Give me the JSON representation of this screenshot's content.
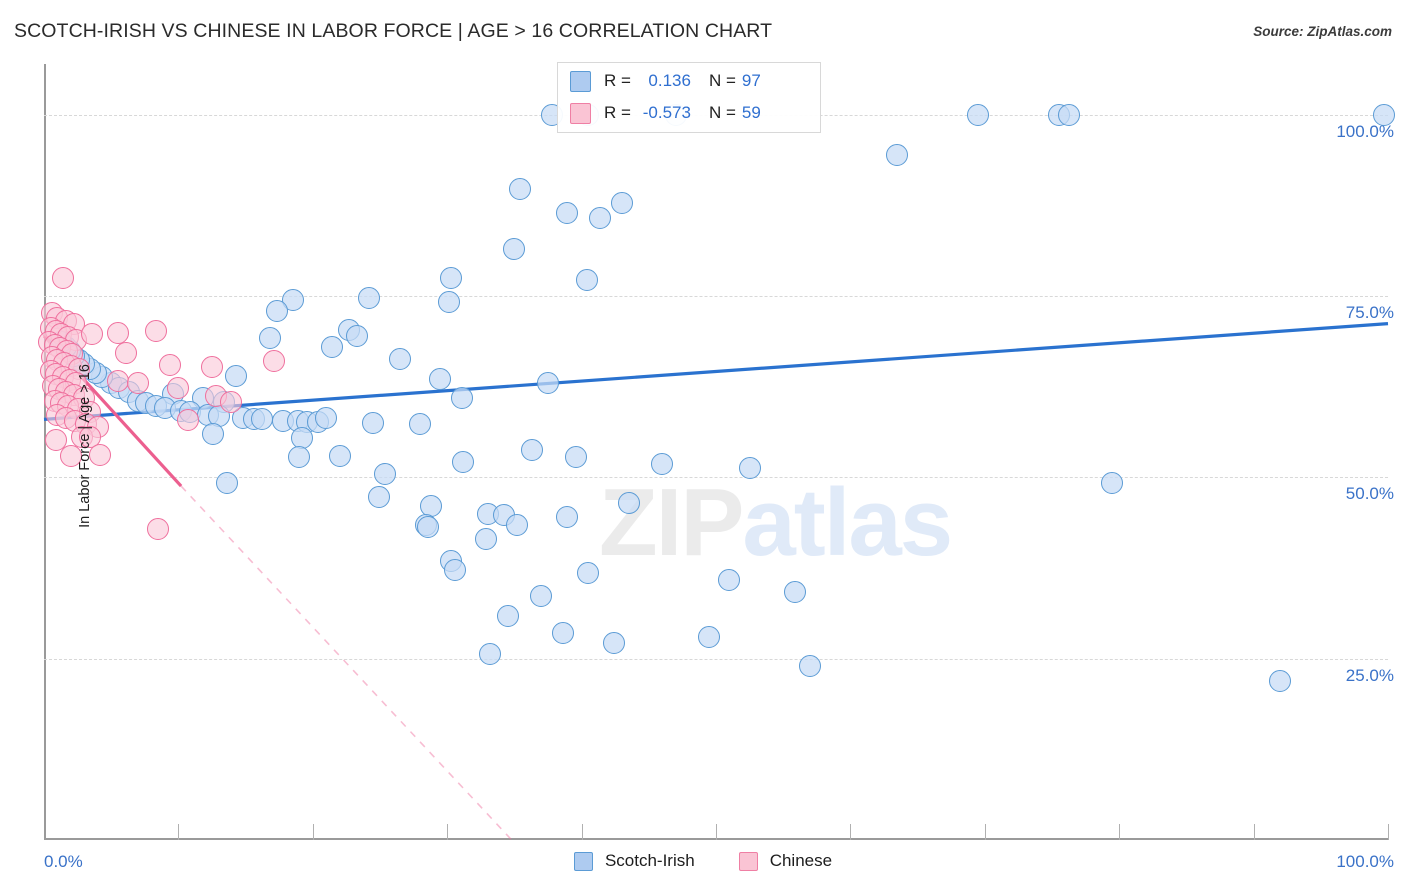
{
  "header": {
    "title": "SCOTCH-IRISH VS CHINESE IN LABOR FORCE | AGE > 16 CORRELATION CHART",
    "source": "Source: ZipAtlas.com"
  },
  "watermark": {
    "part1": "ZIP",
    "part2": "atlas"
  },
  "stats": {
    "blue": {
      "r_label": "R =",
      "r_value": "0.136",
      "n_label": "N =",
      "n_value": "97"
    },
    "pink": {
      "r_label": "R =",
      "r_value": "-0.573",
      "n_label": "N =",
      "n_value": "59"
    }
  },
  "legend": [
    {
      "label": "Scotch-Irish",
      "color": "#aecbf0"
    },
    {
      "label": "Chinese",
      "color": "#fac4d4"
    }
  ],
  "axes": {
    "y_title": "In Labor Force | Age > 16",
    "y_ticks": [
      "100.0%",
      "75.0%",
      "50.0%",
      "25.0%"
    ],
    "x_min": "0.0%",
    "x_max": "100.0%"
  },
  "chart_data": {
    "type": "scatter",
    "title": "SCOTCH-IRISH VS CHINESE IN LABOR FORCE | AGE > 16 CORRELATION CHART",
    "xlabel": "",
    "ylabel": "In Labor Force | Age > 16",
    "xlim": [
      0,
      100
    ],
    "ylim": [
      0,
      107
    ],
    "x_ticks": [
      0,
      10,
      20,
      30,
      40,
      50,
      60,
      70,
      80,
      90,
      100
    ],
    "y_gridlines": [
      25,
      50,
      75,
      100
    ],
    "grid": true,
    "legend_position": "bottom-center",
    "accent_blue": "#3a72c8",
    "accent_pink": "#ef6f9d",
    "series": [
      {
        "name": "Scotch-Irish",
        "r": 0.136,
        "n": 97,
        "color": "#aecbf0",
        "edge": "#5b9bd5",
        "trendline": {
          "x0": 0,
          "y0": 58.0,
          "x1": 100,
          "y1": 71.2,
          "style": "solid"
        },
        "points": [
          [
            37.8,
            100.0
          ],
          [
            40.5,
            100.0
          ],
          [
            47.0,
            100.0
          ],
          [
            69.5,
            100.0
          ],
          [
            75.5,
            100.0
          ],
          [
            76.3,
            100.0
          ],
          [
            99.7,
            100.0
          ],
          [
            63.5,
            94.5
          ],
          [
            35.4,
            89.8
          ],
          [
            43.0,
            87.8
          ],
          [
            38.9,
            86.5
          ],
          [
            41.4,
            85.7
          ],
          [
            35.0,
            81.5
          ],
          [
            30.3,
            77.5
          ],
          [
            40.4,
            77.2
          ],
          [
            18.5,
            74.5
          ],
          [
            24.2,
            74.8
          ],
          [
            30.1,
            74.2
          ],
          [
            17.3,
            73.0
          ],
          [
            22.7,
            70.3
          ],
          [
            16.8,
            69.2
          ],
          [
            23.3,
            69.5
          ],
          [
            21.4,
            68.0
          ],
          [
            26.5,
            66.3
          ],
          [
            14.3,
            64.0
          ],
          [
            29.5,
            63.5
          ],
          [
            37.5,
            63.0
          ],
          [
            9.6,
            61.5
          ],
          [
            11.8,
            61.0
          ],
          [
            13.4,
            60.4
          ],
          [
            31.1,
            61.0
          ],
          [
            5.0,
            63.0
          ],
          [
            5.6,
            62.3
          ],
          [
            6.3,
            61.8
          ],
          [
            4.3,
            63.8
          ],
          [
            3.9,
            64.4
          ],
          [
            3.4,
            65.0
          ],
          [
            3.0,
            65.6
          ],
          [
            2.6,
            66.2
          ],
          [
            2.2,
            66.8
          ],
          [
            1.9,
            67.4
          ],
          [
            1.6,
            68.0
          ],
          [
            1.3,
            68.6
          ],
          [
            7.0,
            60.5
          ],
          [
            7.6,
            60.2
          ],
          [
            8.3,
            59.9
          ],
          [
            9.0,
            59.6
          ],
          [
            10.2,
            59.2
          ],
          [
            10.9,
            59.0
          ],
          [
            12.2,
            58.6
          ],
          [
            13.0,
            58.4
          ],
          [
            14.8,
            58.2
          ],
          [
            15.6,
            58.0
          ],
          [
            16.2,
            58.0
          ],
          [
            17.8,
            57.8
          ],
          [
            18.9,
            57.8
          ],
          [
            19.6,
            57.7
          ],
          [
            20.4,
            57.7
          ],
          [
            21.0,
            58.2
          ],
          [
            12.6,
            56.0
          ],
          [
            19.2,
            55.4
          ],
          [
            24.5,
            57.5
          ],
          [
            28.0,
            57.4
          ],
          [
            19.0,
            52.8
          ],
          [
            13.6,
            49.2
          ],
          [
            22.0,
            53.0
          ],
          [
            25.4,
            50.5
          ],
          [
            24.9,
            47.3
          ],
          [
            28.8,
            46.0
          ],
          [
            31.2,
            52.1
          ],
          [
            33.0,
            44.9
          ],
          [
            34.2,
            44.8
          ],
          [
            36.3,
            53.8
          ],
          [
            32.9,
            41.5
          ],
          [
            28.4,
            43.5
          ],
          [
            28.6,
            43.2
          ],
          [
            30.3,
            38.5
          ],
          [
            30.6,
            37.2
          ],
          [
            35.2,
            43.5
          ],
          [
            38.9,
            44.6
          ],
          [
            40.5,
            36.8
          ],
          [
            37.0,
            33.6
          ],
          [
            34.5,
            30.9
          ],
          [
            38.6,
            28.5
          ],
          [
            33.2,
            25.7
          ],
          [
            42.4,
            27.1
          ],
          [
            49.5,
            28.0
          ],
          [
            52.5,
            51.3
          ],
          [
            51.0,
            35.9
          ],
          [
            55.9,
            34.2
          ],
          [
            57.0,
            24.0
          ],
          [
            39.6,
            52.8
          ],
          [
            43.5,
            46.5
          ],
          [
            46.0,
            51.8
          ],
          [
            79.5,
            49.2
          ],
          [
            92.0,
            21.9
          ]
        ]
      },
      {
        "name": "Chinese",
        "r": -0.573,
        "n": 59,
        "color": "#fac4d4",
        "edge": "#ef6f9d",
        "trendline": {
          "x0": 0,
          "y0": 69.5,
          "x1": 10.2,
          "y1": 48.8,
          "style": "solid"
        },
        "trendline_extension": {
          "x0": 10.2,
          "y0": 48.8,
          "x1": 34.8,
          "y1": 0.0,
          "style": "dashed"
        },
        "points": [
          [
            1.4,
            77.5
          ],
          [
            0.6,
            72.6
          ],
          [
            1.0,
            72.0
          ],
          [
            1.6,
            71.6
          ],
          [
            2.2,
            71.2
          ],
          [
            0.5,
            70.6
          ],
          [
            0.9,
            70.2
          ],
          [
            1.3,
            69.8
          ],
          [
            1.8,
            69.4
          ],
          [
            2.4,
            69.0
          ],
          [
            0.4,
            68.6
          ],
          [
            0.8,
            68.2
          ],
          [
            1.2,
            67.8
          ],
          [
            1.7,
            67.4
          ],
          [
            2.1,
            67.0
          ],
          [
            0.6,
            66.6
          ],
          [
            1.0,
            66.2
          ],
          [
            1.5,
            65.8
          ],
          [
            2.0,
            65.4
          ],
          [
            2.6,
            65.0
          ],
          [
            0.5,
            64.6
          ],
          [
            0.9,
            64.2
          ],
          [
            1.4,
            63.8
          ],
          [
            1.9,
            63.4
          ],
          [
            2.4,
            63.0
          ],
          [
            0.7,
            62.6
          ],
          [
            1.1,
            62.2
          ],
          [
            1.6,
            61.8
          ],
          [
            2.2,
            61.4
          ],
          [
            3.0,
            61.0
          ],
          [
            0.8,
            60.6
          ],
          [
            1.3,
            60.2
          ],
          [
            1.8,
            59.8
          ],
          [
            2.5,
            59.4
          ],
          [
            3.4,
            59.0
          ],
          [
            1.0,
            58.6
          ],
          [
            1.6,
            58.2
          ],
          [
            2.3,
            57.8
          ],
          [
            3.1,
            57.4
          ],
          [
            4.0,
            57.0
          ],
          [
            3.6,
            69.8
          ],
          [
            5.5,
            69.9
          ],
          [
            8.3,
            70.2
          ],
          [
            6.1,
            67.2
          ],
          [
            9.4,
            65.5
          ],
          [
            12.5,
            65.2
          ],
          [
            17.1,
            66.1
          ],
          [
            5.5,
            63.3
          ],
          [
            7.0,
            63.0
          ],
          [
            10.0,
            62.3
          ],
          [
            12.8,
            61.2
          ],
          [
            13.9,
            60.4
          ],
          [
            10.7,
            57.9
          ],
          [
            2.8,
            55.5
          ],
          [
            0.9,
            55.2
          ],
          [
            3.4,
            55.5
          ],
          [
            2.0,
            52.9
          ],
          [
            4.2,
            53.1
          ],
          [
            8.5,
            42.9
          ]
        ]
      }
    ]
  }
}
